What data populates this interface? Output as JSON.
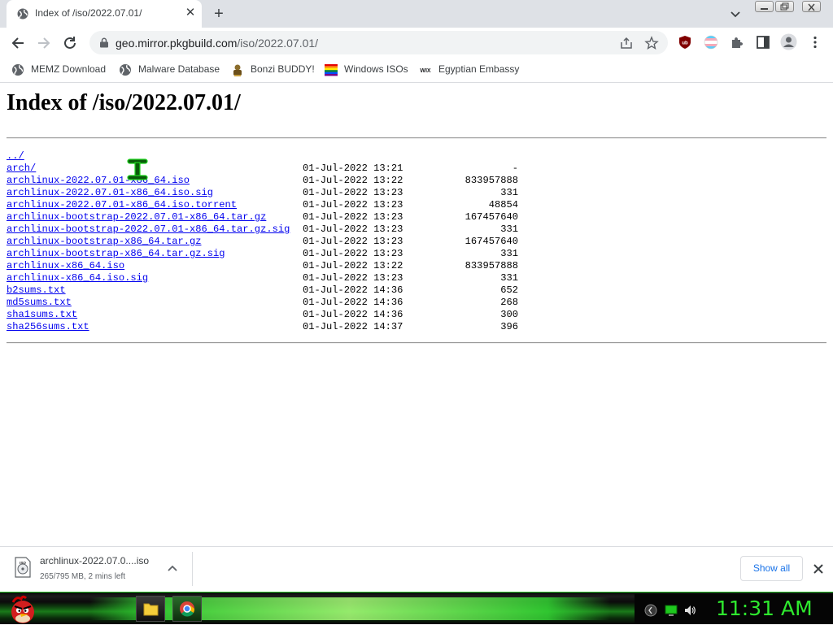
{
  "browser": {
    "tab": {
      "title": "Index of /iso/2022.07.01/"
    },
    "address": {
      "host": "geo.mirror.pkgbuild.com",
      "path": "/iso/2022.07.01/"
    },
    "bookmarks": [
      {
        "label": "MEMZ Download",
        "icon": "globe-icon"
      },
      {
        "label": "Malware Database",
        "icon": "globe-icon"
      },
      {
        "label": "Bonzi BUDDY!",
        "icon": "bonzi-icon"
      },
      {
        "label": "Windows ISOs",
        "icon": "windows-flag-icon"
      },
      {
        "label": "Egyptian Embassy",
        "icon": "wix-icon"
      }
    ]
  },
  "page": {
    "heading": "Index of /iso/2022.07.01/",
    "entries": [
      {
        "name": "../",
        "date": "",
        "size": ""
      },
      {
        "name": "arch/",
        "date": "01-Jul-2022 13:21",
        "size": "-"
      },
      {
        "name": "archlinux-2022.07.01-x86_64.iso",
        "date": "01-Jul-2022 13:22",
        "size": "833957888"
      },
      {
        "name": "archlinux-2022.07.01-x86_64.iso.sig",
        "date": "01-Jul-2022 13:23",
        "size": "331"
      },
      {
        "name": "archlinux-2022.07.01-x86_64.iso.torrent",
        "date": "01-Jul-2022 13:23",
        "size": "48854"
      },
      {
        "name": "archlinux-bootstrap-2022.07.01-x86_64.tar.gz",
        "date": "01-Jul-2022 13:23",
        "size": "167457640"
      },
      {
        "name": "archlinux-bootstrap-2022.07.01-x86_64.tar.gz.sig",
        "date": "01-Jul-2022 13:23",
        "size": "331"
      },
      {
        "name": "archlinux-bootstrap-x86_64.tar.gz",
        "date": "01-Jul-2022 13:23",
        "size": "167457640"
      },
      {
        "name": "archlinux-bootstrap-x86_64.tar.gz.sig",
        "date": "01-Jul-2022 13:23",
        "size": "331"
      },
      {
        "name": "archlinux-x86_64.iso",
        "date": "01-Jul-2022 13:22",
        "size": "833957888"
      },
      {
        "name": "archlinux-x86_64.iso.sig",
        "date": "01-Jul-2022 13:23",
        "size": "331"
      },
      {
        "name": "b2sums.txt",
        "date": "01-Jul-2022 14:36",
        "size": "652"
      },
      {
        "name": "md5sums.txt",
        "date": "01-Jul-2022 14:36",
        "size": "268"
      },
      {
        "name": "sha1sums.txt",
        "date": "01-Jul-2022 14:36",
        "size": "300"
      },
      {
        "name": "sha256sums.txt",
        "date": "01-Jul-2022 14:37",
        "size": "396"
      }
    ]
  },
  "downloads": {
    "item": {
      "name": "archlinux-2022.07.0....iso",
      "status": "265/795 MB, 2 mins left"
    },
    "show_all": "Show all"
  },
  "taskbar": {
    "clock": "11:31 AM"
  },
  "colors": {
    "link": "#0000ee",
    "taskbar_glow": "#34d434",
    "clock": "#2ee82e",
    "tab_strip": "#dee1e6"
  }
}
